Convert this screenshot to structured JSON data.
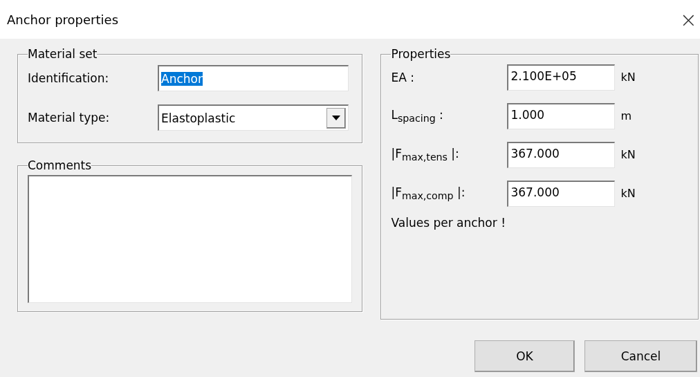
{
  "window": {
    "title": "Anchor properties",
    "close": "×"
  },
  "material_set": {
    "legend": "Material set",
    "identification": {
      "label": "Identification:",
      "value": "Anchor",
      "text_selected": true
    },
    "material_type": {
      "label": "Material type:",
      "value": "Elastoplastic"
    }
  },
  "comments": {
    "legend": "Comments"
  },
  "properties": {
    "legend": "Properties",
    "rows": [
      {
        "label": "EA :",
        "value": "2.100E+05",
        "unit": "kN"
      },
      {
        "label": "L$_{spacing}$ :",
        "value": "1.000",
        "unit": "m"
      },
      {
        "label": "|F$_{max,tens}$ |:",
        "value": "367.000",
        "unit": "kN"
      },
      {
        "label": "|F$_{max,comp}$ |:",
        "value": "367.000",
        "unit": "kN"
      }
    ],
    "note": "Values per anchor !"
  },
  "buttons": [
    "OK",
    "Cancel"
  ]
}
